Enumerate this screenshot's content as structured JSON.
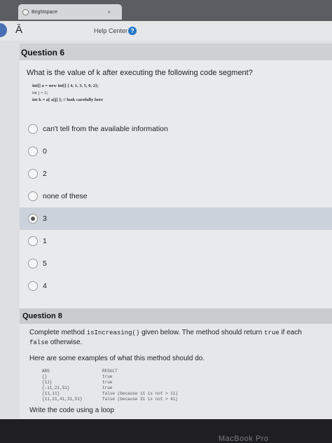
{
  "browser": {
    "tab_title": "Brightspace",
    "tab_close": "×",
    "window_close": "×"
  },
  "navbar": {
    "site_badge": "Ā",
    "help_center": "Help Center",
    "help_icon": "?"
  },
  "question6": {
    "title": "Question 6",
    "prompt": "What is the value of k after executing the following code segment?",
    "code": [
      "int[] a = new int[] { 4, 1, 3, 5, 0, 2};",
      "int j = 2;",
      "int k = a[ a[j] ];  // look carefully here"
    ],
    "options": [
      {
        "label": "can't tell from the available information",
        "selected": false
      },
      {
        "label": "0",
        "selected": false
      },
      {
        "label": "2",
        "selected": false
      },
      {
        "label": "none of these",
        "selected": false
      },
      {
        "label": "3",
        "selected": true
      },
      {
        "label": "1",
        "selected": false
      },
      {
        "label": "5",
        "selected": false
      },
      {
        "label": "4",
        "selected": false
      }
    ]
  },
  "question8": {
    "title": "Question 8",
    "text_prefix": "Complete method ",
    "method": "isIncreasing()",
    "text_mid": " given below. The method should return ",
    "true_kw": "true",
    "text_end": " if each",
    "false_kw": "false",
    "text_otherwise": " otherwise.",
    "examples_intro": "Here are some examples of what this method should do.",
    "examples_header": {
      "arg": "ARG",
      "result": "RESULT"
    },
    "examples": [
      {
        "arg": "{}",
        "result": "true"
      },
      {
        "arg": "{11}",
        "result": "true"
      },
      {
        "arg": "{-11,21,51}",
        "result": "true"
      },
      {
        "arg": "{11,11}",
        "result": "false (because 11 is not > 11)"
      },
      {
        "arg": "{11,21,41,31,51}",
        "result": "false (because 31 is not > 41)"
      }
    ],
    "loop_text": "Write the code using a loop"
  },
  "device": {
    "brand": "MacBook Pro"
  }
}
